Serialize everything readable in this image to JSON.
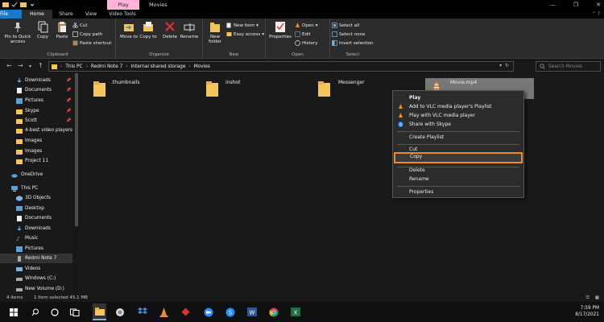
{
  "titlebar": {
    "play_tab": "Play",
    "title": "Movies",
    "controls": [
      "—",
      "❐",
      "✕"
    ]
  },
  "ribbon_tabs": [
    "File",
    "Home",
    "Share",
    "View",
    "Video Tools"
  ],
  "ribbon": {
    "clipboard": {
      "pin": "Pin to Quick access",
      "copy": "Copy",
      "paste": "Paste",
      "cut": "Cut",
      "copy_path": "Copy path",
      "paste_shortcut": "Paste shortcut",
      "label": "Clipboard"
    },
    "organize": {
      "move_to": "Move to",
      "copy_to": "Copy to",
      "delete": "Delete",
      "rename": "Rename",
      "label": "Organize"
    },
    "new": {
      "new_folder": "New folder",
      "new_item": "New item",
      "easy_access": "Easy access",
      "label": "New"
    },
    "open": {
      "properties": "Properties",
      "open": "Open",
      "edit": "Edit",
      "history": "History",
      "label": "Open"
    },
    "select": {
      "select_all": "Select all",
      "select_none": "Select none",
      "invert_selection": "Invert selection",
      "label": "Select"
    }
  },
  "address": {
    "crumbs": [
      "This PC",
      "Redmi Note 7",
      "Internal shared storage",
      "Movies"
    ],
    "search_placeholder": "Search Movies"
  },
  "sidebar": {
    "items": [
      {
        "label": "Downloads",
        "pinned": true
      },
      {
        "label": "Documents",
        "pinned": true
      },
      {
        "label": "Pictures",
        "pinned": true
      },
      {
        "label": "Skype",
        "pinned": true
      },
      {
        "label": "Scott",
        "pinned": true
      },
      {
        "label": "4-best video players",
        "pinned": false
      },
      {
        "label": "Images",
        "pinned": false
      },
      {
        "label": "Images",
        "pinned": false
      },
      {
        "label": "Project 11",
        "pinned": false
      },
      {
        "label": "OneDrive",
        "pinned": false
      },
      {
        "label": "This PC",
        "pinned": false
      },
      {
        "label": "3D Objects",
        "pinned": false
      },
      {
        "label": "Desktop",
        "pinned": false
      },
      {
        "label": "Documents",
        "pinned": false
      },
      {
        "label": "Downloads",
        "pinned": false
      },
      {
        "label": "Music",
        "pinned": false
      },
      {
        "label": "Pictures",
        "pinned": false
      },
      {
        "label": "Redmi Note 7",
        "pinned": false
      },
      {
        "label": "Videos",
        "pinned": false
      },
      {
        "label": "Windows (C:)",
        "pinned": false
      },
      {
        "label": "New Volume (D:)",
        "pinned": false
      }
    ]
  },
  "files": [
    {
      "name": ".thumbnails",
      "type": "folder"
    },
    {
      "name": "inshot",
      "type": "folder"
    },
    {
      "name": "Messenger",
      "type": "folder"
    },
    {
      "name": "Movie.mp4",
      "type": "video"
    }
  ],
  "context_menu": {
    "items": [
      "Play",
      "Add to VLC media player's Playlist",
      "Play with VLC media player",
      "Share with Skype",
      "Create Playlist",
      "Cut",
      "Copy",
      "Delete",
      "Rename",
      "Properties"
    ]
  },
  "status": {
    "items": "4 items",
    "selected": "1 item selected  45.1 MB"
  },
  "clock": {
    "time": "7:59 PM",
    "date": "8/17/2021"
  },
  "colors": {
    "accent": "#1979ca",
    "highlight": "#f08a24",
    "folder": "#f4c55a",
    "play_tab": "#ffb3d6"
  }
}
